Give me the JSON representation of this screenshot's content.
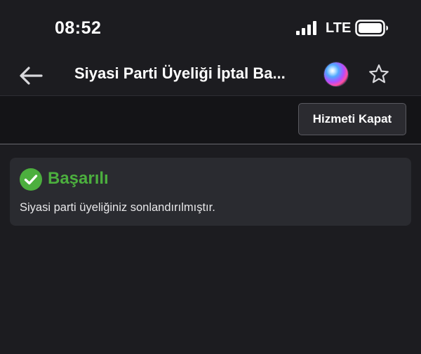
{
  "status_bar": {
    "time": "08:52",
    "network": "LTE",
    "icons": [
      "signal-icon",
      "battery-icon"
    ]
  },
  "nav": {
    "title": "Siyasi Parti Üyeliği İptal Ba...",
    "icons": [
      "back-arrow-icon",
      "siri-icon",
      "star-icon"
    ]
  },
  "toolbar": {
    "close_service_label": "Hizmeti Kapat"
  },
  "alert": {
    "title": "Başarılı",
    "message": "Siyasi parti üyeliğiniz sonlandırılmıştır.",
    "icon": "check-circle-icon",
    "title_color": "#4caf3e"
  },
  "colors": {
    "background": "#1c1c20",
    "toolbar": "#141417",
    "alert_background": "#2a2b30",
    "success": "#4caf3e"
  }
}
